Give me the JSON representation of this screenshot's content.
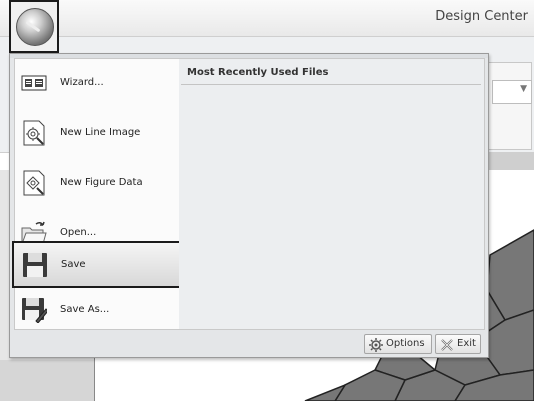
{
  "app": {
    "title": "Design Center"
  },
  "menu": {
    "items": [
      {
        "label": "Wizard...",
        "icon": "wizard-icon"
      },
      {
        "label": "New Line Image",
        "icon": "new-line-image-icon"
      },
      {
        "label": "New Figure Data",
        "icon": "new-figure-data-icon"
      },
      {
        "label": "Open...",
        "icon": "open-folder-icon"
      },
      {
        "label": "Save",
        "icon": "save-disk-icon",
        "selected": true
      },
      {
        "label": "Save As...",
        "icon": "save-as-icon"
      }
    ],
    "recent": {
      "title": "Most Recently Used Files"
    },
    "buttons": {
      "options": "Options",
      "exit": "Exit"
    }
  },
  "colors": {
    "highlight_border": "#1b1b1b",
    "menu_bg": "#e4e6e8"
  }
}
